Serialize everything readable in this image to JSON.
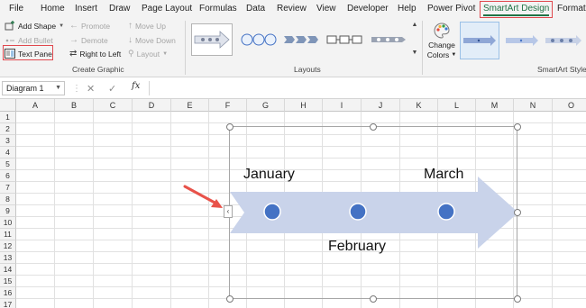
{
  "tabs": [
    "File",
    "Home",
    "Insert",
    "Draw",
    "Page Layout",
    "Formulas",
    "Data",
    "Review",
    "View",
    "Developer",
    "Help",
    "Power Pivot",
    "SmartArt Design",
    "Format"
  ],
  "ribbon": {
    "create_graphic": {
      "add_shape": "Add Shape",
      "add_bullet": "Add Bullet",
      "text_pane": "Text Pane",
      "promote": "Promote",
      "demote": "Demote",
      "right_to_left": "Right to Left",
      "move_up": "Move Up",
      "move_down": "Move Down",
      "layout": "Layout",
      "group_label": "Create Graphic"
    },
    "layouts": {
      "group_label": "Layouts"
    },
    "smartart_styles": {
      "change_colors_line1": "Change",
      "change_colors_line2": "Colors",
      "group_label": "SmartArt Styles"
    }
  },
  "formula_bar": {
    "name_box": "Diagram 1",
    "fx": "fx",
    "formula": ""
  },
  "columns": [
    "A",
    "B",
    "C",
    "D",
    "E",
    "F",
    "G",
    "H",
    "I",
    "J",
    "K",
    "L",
    "M",
    "N",
    "O"
  ],
  "rows": [
    "1",
    "2",
    "3",
    "4",
    "5",
    "6",
    "7",
    "8",
    "9",
    "10",
    "11",
    "12",
    "13",
    "14",
    "15",
    "16",
    "17"
  ],
  "smartart": {
    "items": [
      "January",
      "February",
      "March"
    ]
  },
  "colors": {
    "accent_green": "#217346",
    "highlight_red": "#e0484e",
    "arrow_fill": "#c9d3ea",
    "dot_fill": "#4472c4",
    "annotation_arrow": "#e8524a"
  }
}
